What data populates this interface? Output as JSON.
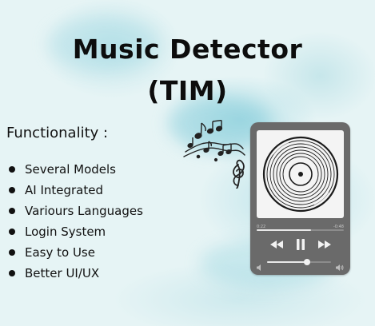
{
  "title": {
    "line1": "Music Detector",
    "line2": "(TIM)"
  },
  "functionality": {
    "heading": "Functionality :",
    "items": [
      "Several Models",
      "AI Integrated",
      "Variours Languages",
      "Login System",
      "Easy to Use",
      "Better UI/UX"
    ]
  },
  "player": {
    "elapsed": "0:22",
    "remaining": "-0:48",
    "progress": 0.62,
    "volume": 0.62,
    "icons": {
      "artwork": "vinyl-record-icon",
      "previous": "rewind-icon",
      "play_pause": "pause-icon",
      "next": "fast-forward-icon",
      "volume_low": "speaker-low-icon",
      "volume_high": "speaker-high-icon"
    }
  },
  "decoration": {
    "notes": "music-notes-icon"
  },
  "colors": {
    "background": "#e6f4f5",
    "watercolor": "#8fd0dc",
    "title": "#0d0d0d",
    "player_body": "#6a6a6a",
    "player_screen": "#f4f4f4",
    "controls": "#f2f2f2"
  }
}
